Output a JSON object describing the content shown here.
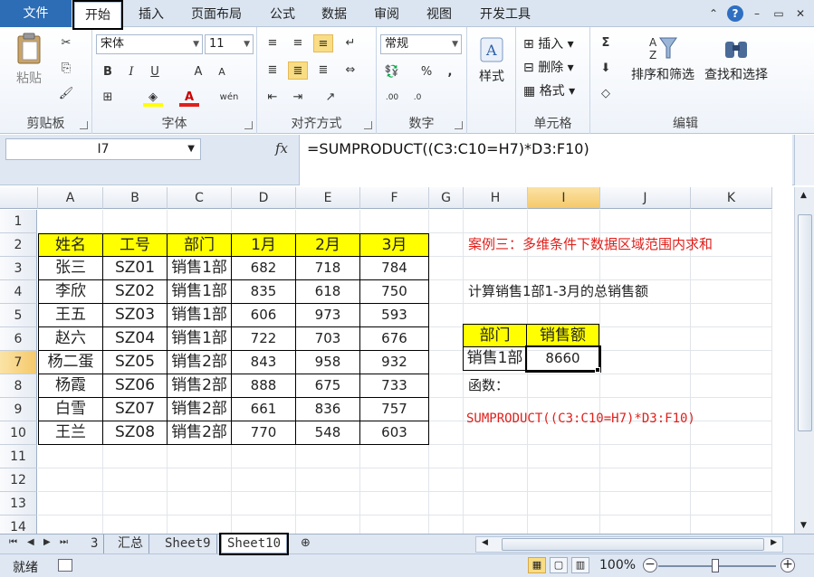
{
  "ribbon_tabs": [
    "文件",
    "开始",
    "插入",
    "页面布局",
    "公式",
    "数据",
    "审阅",
    "视图",
    "开发工具"
  ],
  "window": {
    "help": "?",
    "minimize": "⌃",
    "restore": "▭",
    "close": "✕"
  },
  "ribbon": {
    "clipboard": {
      "paste": "粘贴",
      "label": "剪贴板"
    },
    "font": {
      "name": "宋体",
      "size": "11",
      "bold": "B",
      "italic": "I",
      "underline": "U",
      "grow": "A",
      "shrink": "A",
      "label": "字体"
    },
    "alignment": {
      "label": "对齐方式"
    },
    "number": {
      "format": "常规",
      "percent": "%",
      "comma": ",",
      "label": "数字"
    },
    "styles": {
      "label": "样式"
    },
    "cells": {
      "insert": "插入",
      "delete": "删除",
      "format": "格式",
      "label": "单元格"
    },
    "editing": {
      "sum": "Σ",
      "sort": "排序和筛选",
      "find": "查找和选择",
      "label": "编辑"
    }
  },
  "formula_bar": {
    "name_box": "I7",
    "fx": "fx",
    "formula": "=SUMPRODUCT((C3:C10=H7)*D3:F10)"
  },
  "columns": [
    "A",
    "B",
    "C",
    "D",
    "E",
    "F",
    "G",
    "H",
    "I",
    "J",
    "K"
  ],
  "rows": [
    "1",
    "2",
    "3",
    "4",
    "5",
    "6",
    "7",
    "8",
    "9",
    "10",
    "11",
    "12",
    "13",
    "14"
  ],
  "selected": {
    "column": "I",
    "row": "7"
  },
  "table": {
    "headers": [
      "姓名",
      "工号",
      "部门",
      "1月",
      "2月",
      "3月"
    ],
    "rows": [
      [
        "张三",
        "SZ01",
        "销售1部",
        "682",
        "718",
        "784"
      ],
      [
        "李欣",
        "SZ02",
        "销售1部",
        "835",
        "618",
        "750"
      ],
      [
        "王五",
        "SZ03",
        "销售1部",
        "606",
        "973",
        "593"
      ],
      [
        "赵六",
        "SZ04",
        "销售1部",
        "722",
        "703",
        "676"
      ],
      [
        "杨二蛋",
        "SZ05",
        "销售2部",
        "843",
        "958",
        "932"
      ],
      [
        "杨霞",
        "SZ06",
        "销售2部",
        "888",
        "675",
        "733"
      ],
      [
        "白雪",
        "SZ07",
        "销售2部",
        "661",
        "836",
        "757"
      ],
      [
        "王兰",
        "SZ08",
        "销售2部",
        "770",
        "548",
        "603"
      ]
    ]
  },
  "notes": {
    "title": "案例三：多维条件下数据区域范围内求和",
    "task": "计算销售1部1-3月的总销售额",
    "func_label": "函数：",
    "func": "SUMPRODUCT((C3:C10=H7)*D3:F10)"
  },
  "lookup": {
    "header_dept": "部门",
    "header_sales": "销售额",
    "dept": "销售1部",
    "sales": "8660"
  },
  "sheet_tabs": [
    "3",
    "汇总",
    "Sheet9",
    "Sheet10"
  ],
  "active_sheet": "Sheet10",
  "status": {
    "ready": "就绪",
    "zoom": "100%"
  },
  "colors": {
    "header_fill": "#ffff00",
    "accent_red": "#e0201b",
    "file_tab": "#2c6db5"
  }
}
